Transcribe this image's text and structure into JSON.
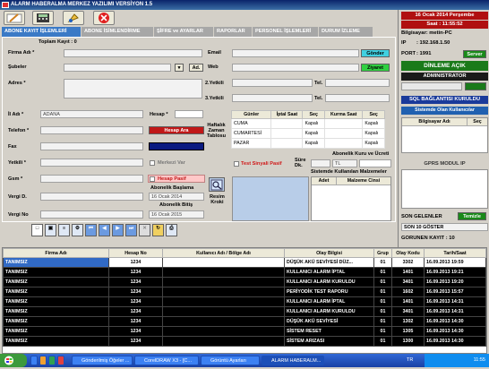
{
  "window": {
    "title": "ALARM HABERALMA MERKEZ YAZILIMI   VERSİYON 1.5"
  },
  "toolbar": {
    "buttons": [
      "edit-icon",
      "calculator-icon",
      "paint-icon",
      "close-icon"
    ]
  },
  "tabs": [
    {
      "label": "ABONE KAYIT İŞLEMLERİ",
      "active": true
    },
    {
      "label": "ABONE İSİMLENDİRME"
    },
    {
      "label": "ŞİFRE ve AYARLAR"
    },
    {
      "label": "RAPORLAR"
    },
    {
      "label": "PERSONEL İŞLEMLERİ"
    },
    {
      "label": "DURUM İZLEME"
    }
  ],
  "form": {
    "total": "Toplam Kayıt : 0",
    "firma": "Firma Adı *",
    "sube": "Şubeler",
    "ad_btn": "Ad.",
    "adres": "Adres *",
    "email": "Email",
    "web": "Web",
    "gonder": "Gönder",
    "ziyaret": "Ziyaret",
    "yetkili2": "2.Yetkili",
    "yetkili3": "3.Yetkili",
    "tel": "Tel.",
    "il": "İl Adı *",
    "il_value": "ADANA",
    "hesap": "Hesap *",
    "telefon": "Telefon *",
    "hesap_ara": "Hesap Ara",
    "fax": "Fax",
    "yetkili": "Yetkili  *",
    "merkezi_var": "Merkezi Var",
    "gsm": "Gsm *",
    "hesap_pasif": "Hesap Pasif",
    "vergi_d": "Vergi D.",
    "vergi_no": "Vergi No",
    "abonelik_baslama": "Abonelik Başlama",
    "abonelik_bitis": "Abonelik Bitiş",
    "start_date": "16  Ocak  2014",
    "end_date": "16  Ocak  2015",
    "resim": "Resim\nKroki",
    "haftalik": "Haftalık\nZaman\nTablosu",
    "test_sinyali": "Test Sinyali Pasif",
    "sure": "Süre\nDk.",
    "abonelik_kuru": "Abonelik Kuru ve Ücreti",
    "tl": "TL",
    "sistemde_malz": "Sistemde Kullanılan Malzemeler",
    "adet": "Adet",
    "malzeme": "Malzeme Cinsi"
  },
  "schedule": {
    "headers": [
      "Günler",
      "İptal Saat",
      "Seç",
      "Kurma Saat",
      "Seç"
    ],
    "rows": [
      [
        "CUMA",
        "",
        "Kapalı",
        "",
        "Kapalı"
      ],
      [
        "CUMARTESİ",
        "",
        "Kapalı",
        "",
        "Kapalı"
      ],
      [
        "PAZAR",
        "",
        "Kapalı",
        "",
        "Kapalı"
      ]
    ]
  },
  "right": {
    "date": "16 Ocak 2014 Perşembe",
    "time": "Saat : 11:55:52",
    "computer": "Bilgisayar: metin-PC",
    "ip_label": "IP",
    "ip": ": 192.168.1.50",
    "port_label": "PORT",
    "port": ": 1991",
    "server": "Server",
    "dinleme": "DİNLEME AÇIK",
    "admin": "ADMINISTRATOR",
    "sql": "SQL BAĞLANTISI KURULDU",
    "online_users": "Sistemde Olan Kullanıcılar",
    "pc_col": "Bilgisayar Adı",
    "sec_col": "Seç",
    "gprs": "GPRS MODUL IP",
    "son_gelenler": "SON GELENLER",
    "temizle": "Temizle",
    "son10": "SON 10 GÖSTER",
    "gorunen": "GÖRÜNEN KAYIT :  10"
  },
  "grid": {
    "headers": [
      "Firma Adı",
      "Hesap No",
      "Kullanıcı Adı / Bölge Adı",
      "Olay Bilgisi",
      "Grup",
      "Olay Kodu",
      "Tarih/Saat"
    ],
    "rows": [
      [
        "TANIMSIZ",
        "1234",
        "",
        "DÜŞÜK AKÜ SEVİYESİ DÜZ...",
        "01",
        "3302",
        "16.09.2013 19:59"
      ],
      [
        "TANIMSIZ",
        "1234",
        "",
        "KULLANICI ALARM İPTAL",
        "01",
        "1401",
        "16.09.2013 19:21"
      ],
      [
        "TANIMSIZ",
        "1234",
        "",
        "KULLANICI ALARM KURULDU",
        "01",
        "3401",
        "16.09.2013 19:20"
      ],
      [
        "TANIMSIZ",
        "1234",
        "",
        "PERİYODİK TEST RAPORU",
        "01",
        "1602",
        "16.09.2013 15:57"
      ],
      [
        "TANIMSIZ",
        "1234",
        "",
        "KULLANICI ALARM İPTAL",
        "01",
        "1401",
        "16.09.2013 14:31"
      ],
      [
        "TANIMSIZ",
        "1234",
        "",
        "KULLANICI ALARM KURULDU",
        "01",
        "3401",
        "16.09.2013 14:31"
      ],
      [
        "TANIMSIZ",
        "1234",
        "",
        "DÜŞÜK AKÜ SEVİYESİ",
        "01",
        "1302",
        "16.09.2013 14:30"
      ],
      [
        "TANIMSIZ",
        "1234",
        "",
        "SİSTEM RESET",
        "01",
        "1305",
        "16.09.2013 14:30"
      ],
      [
        "TANIMSIZ",
        "1234",
        "",
        "SİSTEM ARIZASI",
        "01",
        "1300",
        "16.09.2013 14:30"
      ]
    ]
  },
  "taskbar": {
    "items": [
      "Gönderilmiş Öğeler ...",
      "CorelDRAW X3 - [C...",
      "Görüntü Ayarları",
      "ALARM HABERALM..."
    ],
    "lang": "TR",
    "clock": "11:55"
  }
}
